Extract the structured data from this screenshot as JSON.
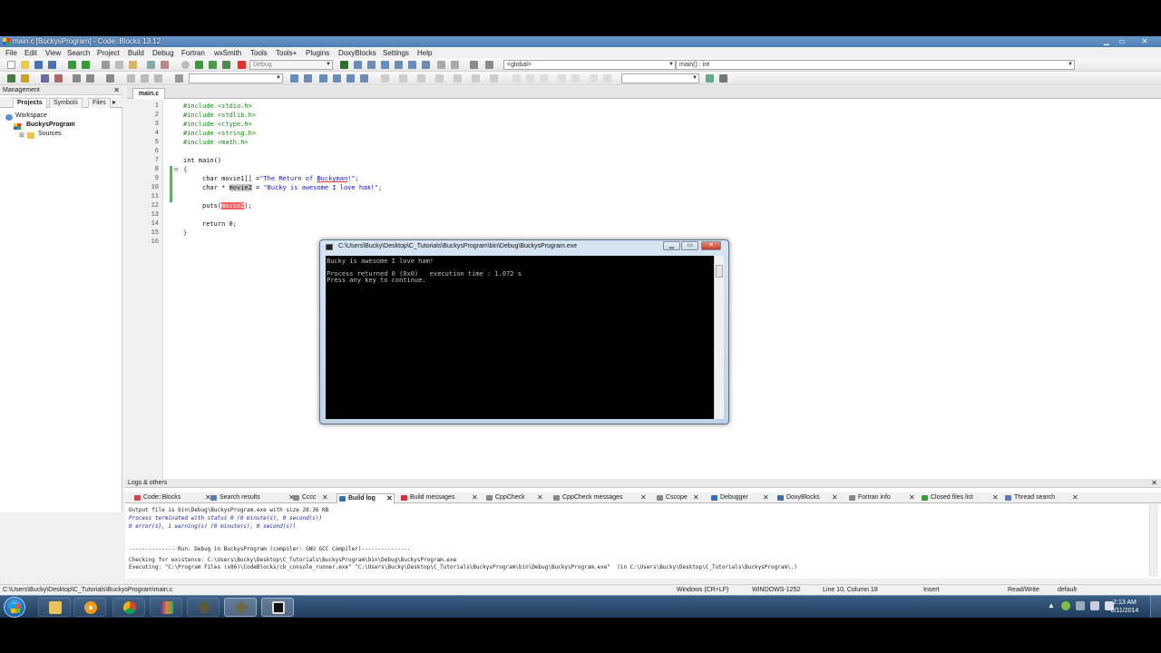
{
  "window": {
    "title": "main.c [BuckysProgram] - Code::Blocks 13.12",
    "min": "▁",
    "max": "▭",
    "close": "✕"
  },
  "menu": [
    "File",
    "Edit",
    "View",
    "Search",
    "Project",
    "Build",
    "Debug",
    "Fortran",
    "wxSmith",
    "Tools",
    "Tools+",
    "Plugins",
    "DoxyBlocks",
    "Settings",
    "Help"
  ],
  "toolbar": {
    "build_target": "Debug",
    "scope": "<global>",
    "function": "main() : int"
  },
  "management": {
    "title": "Management",
    "close": "✕",
    "tabs": [
      "Projects",
      "Symbols",
      "Files"
    ],
    "scroll_arrow": "▸",
    "tree": {
      "workspace": "Workspace",
      "project": "BuckysProgram",
      "sources": "Sources"
    }
  },
  "editor": {
    "tab": "main.c",
    "line_numbers": [
      "1",
      "2",
      "3",
      "4",
      "5",
      "6",
      "7",
      "8",
      "9",
      "10",
      "11",
      "12",
      "13",
      "14",
      "15",
      "16"
    ],
    "lines": {
      "l1": "#include <stdio.h>",
      "l2": "#include <stdlib.h>",
      "l3": "#include <ctype.h>",
      "l4": "#include <string.h>",
      "l5": "#include <math.h>",
      "l7": "int main()",
      "l8": "{",
      "l9a": "char movie1[] =",
      "l9b": "\"The Return of ",
      "l9c": "Buckyman",
      "l9d": "!\";",
      "l10a": "char * ",
      "l10b": "movie2",
      "l10c": " = ",
      "l10d": "\"Bucky is awesome I love ham!\";",
      "l12a": "puts(",
      "l12b": "movie2",
      "l12c": ");",
      "l14": "return 0;",
      "l15": "}"
    }
  },
  "console": {
    "title": "C:\\Users\\Bucky\\Desktop\\C_Tutorials\\BuckysProgram\\bin\\Debug\\BuckysProgram.exe",
    "lines": [
      "Bucky is awesome I love ham!",
      "",
      "Process returned 0 (0x0)   execution time : 1.072 s",
      "Press any key to continue."
    ],
    "btn_min": "▁",
    "btn_max": "▭",
    "btn_close": "✕"
  },
  "logs": {
    "title": "Logs & others",
    "close": "✕",
    "tabs": [
      "Code::Blocks",
      "Search results",
      "Cccc",
      "Build log",
      "Build messages",
      "CppCheck",
      "CppCheck messages",
      "Cscope",
      "Debugger",
      "DoxyBlocks",
      "Fortran info",
      "Closed files list",
      "Thread search"
    ],
    "active_tab": "Build log",
    "lines": [
      "Output file is bin\\Debug\\BuckysProgram.exe with size 28.36 KB",
      "Process terminated with status 0 (0 minute(s), 0 second(s))",
      "0 error(s), 1 warning(s) (0 minute(s), 0 second(s))",
      "",
      "",
      "-------------- Run: Debug in BuckysProgram (compiler: GNU GCC Compiler)---------------",
      "Checking for existence: C:\\Users\\Bucky\\Desktop\\C_Tutorials\\BuckysProgram\\bin\\Debug\\BuckysProgram.exe",
      "Executing: \"C:\\Program Files (x86)\\CodeBlocks/cb_console_runner.exe\" \"C:\\Users\\Bucky\\Desktop\\C_Tutorials\\BuckysProgram\\bin\\Debug\\BuckysProgram.exe\"  (in C:\\Users\\Bucky\\Desktop\\C_Tutorials\\BuckysProgram\\.)"
    ]
  },
  "statusbar": {
    "path": "C:\\Users\\Bucky\\Desktop\\C_Tutorials\\BuckysProgram\\main.c",
    "eol": "Windows (CR+LF)",
    "encoding": "WINDOWS-1252",
    "position": "Line 10, Column 18",
    "mode": "Insert",
    "access": "Read/Write",
    "lang": "default"
  },
  "taskbar": {
    "time": "2:13 AM",
    "date": "8/11/2014",
    "tray_arrow": "▲",
    "apps": [
      "windows-explorer",
      "media-player",
      "chrome",
      "winrar",
      "codeblocks",
      "codeblocks-ide",
      "console"
    ]
  },
  "colors": {
    "preprocessor": "#1c8a1c",
    "string": "#1515d0",
    "titlebar": "#5a88bd",
    "taskbar": "#2a4a6e",
    "console_bg": "#000000",
    "change_marker": "#3ec83e",
    "brace_highlight": "#f26060"
  }
}
